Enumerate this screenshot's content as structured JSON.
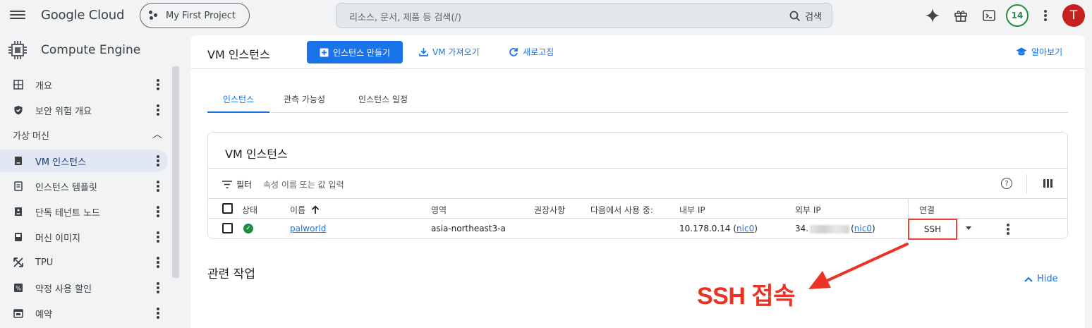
{
  "topbar": {
    "brand": "Google Cloud",
    "project": "My First Project",
    "search_placeholder": "리소스, 문서, 제품 등 검색(/)",
    "search_button": "검색",
    "notification_count": "14",
    "avatar_letter": "T"
  },
  "sidebar": {
    "title": "Compute Engine",
    "items_top": [
      {
        "label": "개요",
        "icon": "dashboard-icon"
      },
      {
        "label": "보안 위험 개요",
        "icon": "shield-icon"
      }
    ],
    "group_label": "가상 머신",
    "items": [
      {
        "label": "VM 인스턴스",
        "icon": "vm-icon",
        "active": true
      },
      {
        "label": "인스턴스 템플릿",
        "icon": "template-icon"
      },
      {
        "label": "단독 테넌트 노드",
        "icon": "node-icon"
      },
      {
        "label": "머신 이미지",
        "icon": "image-icon"
      },
      {
        "label": "TPU",
        "icon": "tpu-icon"
      },
      {
        "label": "약정 사용 할인",
        "icon": "percent-icon"
      },
      {
        "label": "예약",
        "icon": "calendar-icon"
      }
    ]
  },
  "toolbar": {
    "title": "VM 인스턴스",
    "create_button": "인스턴스 만들기",
    "import_button": "VM 가져오기",
    "refresh_button": "새로고침",
    "learn_button": "알아보기"
  },
  "tabs": [
    "인스턴스",
    "관측 가능성",
    "인스턴스 일정"
  ],
  "card": {
    "title": "VM 인스턴스",
    "filter_label": "필터",
    "filter_placeholder": "속성 이름 또는 값 입력",
    "columns": [
      "상태",
      "이름",
      "영역",
      "권장사항",
      "다음에서 사용 중:",
      "내부 IP",
      "외부 IP",
      "연결"
    ],
    "row": {
      "name": "palworld",
      "zone": "asia-northeast3-a",
      "internal_ip": "10.178.0.14",
      "internal_nic": "nic0",
      "external_ip_prefix": "34.",
      "external_nic": "nic0",
      "connect": "SSH"
    }
  },
  "related": {
    "title": "관련 작업",
    "hide": "Hide"
  },
  "annotation": {
    "text": "SSH 접속",
    "color": "#ea3323"
  }
}
